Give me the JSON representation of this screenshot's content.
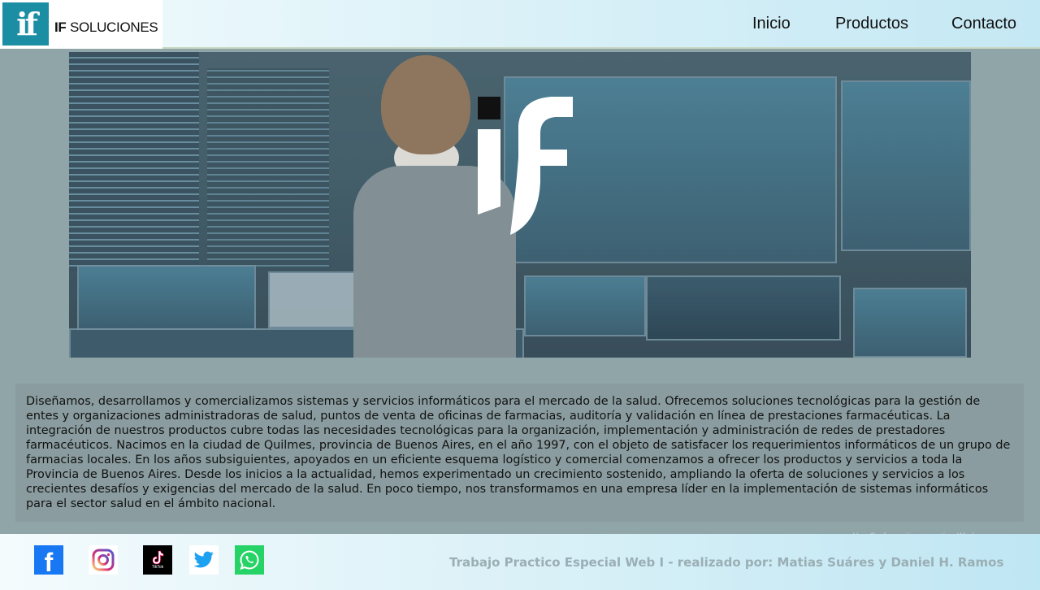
{
  "header": {
    "logo_text_bold": "IF",
    "logo_text_light": "SOLUCIONES",
    "nav": [
      "Inicio",
      "Productos",
      "Contacto"
    ]
  },
  "hero": {
    "logo_letters": "if"
  },
  "description": "Diseñamos, desarrollamos y comercializamos sistemas y servicios informáticos para el mercado de la salud. Ofrecemos soluciones tecnológicas para la gestión de entes y organizaciones administradoras de salud, puntos de venta de oficinas de farmacias, auditoría y validación en línea de prestaciones farmacéuticas. La integración de nuestros productos cubre todas las necesidades tecnológicas para la organización, implementación y administración de redes de prestadores farmacéuticos. Nacimos en la ciudad de Quilmes, provincia de Buenos Aires, en el año 1997, con el objeto de satisfacer los requerimientos informáticos de un grupo de farmacias locales. En los años subsiguientes, apoyados en un eficiente esquema logístico y comercial comenzamos a ofrecer los productos y servicios a toda la Provincia de Buenos Aires. Desde los inicios a la actualidad, hemos experimentado un crecimiento sostenido, ampliando la oferta de soluciones y servicios a los crecientes desafíos y exigencias del mercado de la salud. En poco tiempo, nos transformamos en una empresa líder en la implementación de sistemas informáticos para el sector salud en el ámbito nacional.",
  "watermark": "Ve a Configuración para activar Windows.",
  "footer": {
    "social": [
      {
        "icon": "facebook-icon",
        "label": "f",
        "color": "#1877f2"
      },
      {
        "icon": "instagram-icon",
        "label": "",
        "color": "#e4405f"
      },
      {
        "icon": "tiktok-icon",
        "label": "TikTok",
        "color": "#000000"
      },
      {
        "icon": "twitter-icon",
        "label": "",
        "color": "#1da1f2"
      },
      {
        "icon": "whatsapp-icon",
        "label": "",
        "color": "#25d366"
      }
    ],
    "credit": "Trabajo Practico Especial Web I - realizado por: Matias Suáres y Daniel H. Ramos"
  },
  "colors": {
    "brand": "#1b8ea4",
    "page_bg": "#8fa5a8",
    "description_bg": "#8a9c9f"
  }
}
